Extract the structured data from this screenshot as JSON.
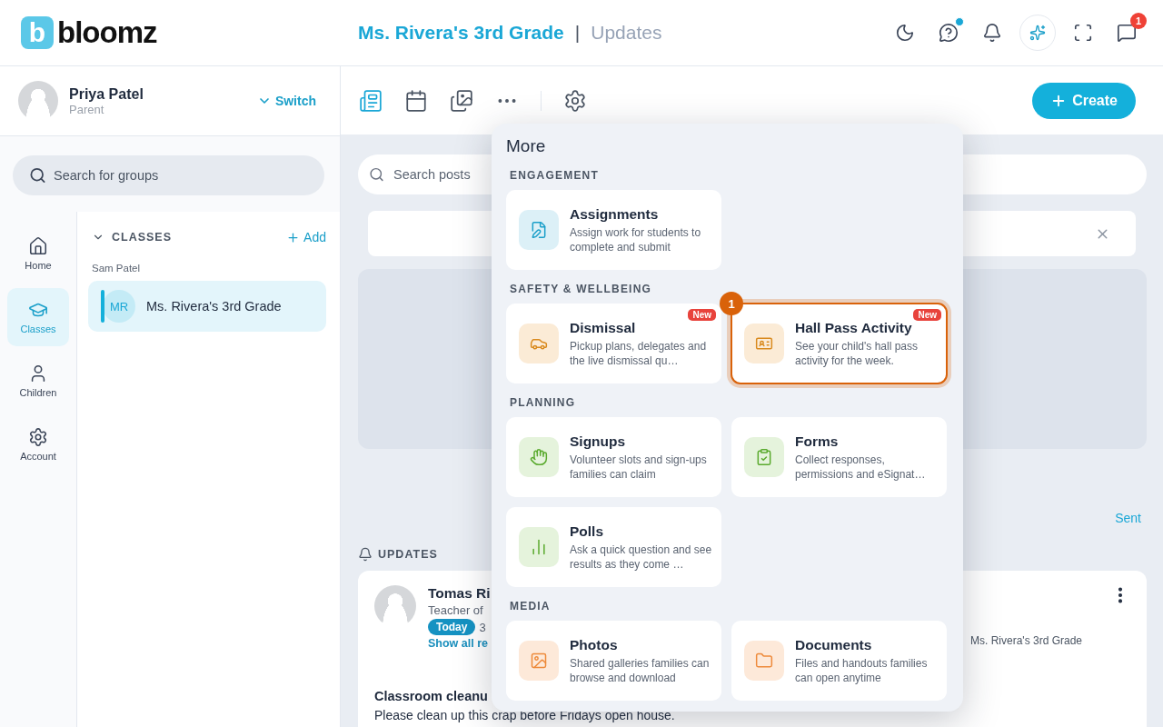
{
  "header": {
    "logo": "b",
    "brand": "bloomz",
    "title": "Ms. Rivera's 3rd Grade",
    "separator": "|",
    "section": "Updates",
    "actions": [
      {
        "kind": "theme"
      },
      {
        "kind": "help",
        "unread": true
      },
      {
        "kind": "notifications"
      },
      {
        "kind": "assistant"
      },
      {
        "kind": "fullscreen"
      },
      {
        "kind": "messages",
        "badge": "1"
      }
    ]
  },
  "profile": {
    "name": "Priya Patel",
    "role": "Parent",
    "switch_label": "Switch"
  },
  "group_search": {
    "placeholder": "Search for groups"
  },
  "nav": [
    {
      "kind": "home",
      "label": "Home",
      "selected": false
    },
    {
      "kind": "classes",
      "label": "Classes",
      "selected": true
    },
    {
      "kind": "children",
      "label": "Children",
      "selected": false
    },
    {
      "kind": "account",
      "label": "Account",
      "selected": false
    }
  ],
  "classes": {
    "heading": "CLASSES",
    "expanded": true,
    "add_label": "Add",
    "child": "Sam Patel",
    "items": [
      {
        "initials": "MR",
        "name": "Ms. Rivera's 3rd Grade",
        "selected": true
      }
    ]
  },
  "toolbar": {
    "tabs": [
      {
        "kind": "posts",
        "selected": true
      },
      {
        "kind": "calendar",
        "selected": false
      },
      {
        "kind": "photos",
        "selected": false
      },
      {
        "kind": "more",
        "selected": false
      },
      {
        "kind": "settings",
        "selected": false
      }
    ],
    "create_label": "Create"
  },
  "posts_search": {
    "placeholder": "Search posts"
  },
  "filter_label": "Sent",
  "updates_heading": "UPDATES",
  "post": {
    "author": "Tomas Ri",
    "role": "Teacher of",
    "tag": "Today",
    "time": "3",
    "link": "Show all re",
    "group": "Ms. Rivera's 3rd Grade",
    "title": "Classroom cleanu",
    "body": "Please clean up this crap before Fridays open house."
  },
  "more_menu": {
    "title": "More",
    "sections": [
      {
        "heading": "ENGAGEMENT",
        "items": [
          {
            "title": "Assignments",
            "description": "Assign work for students to complete and submit",
            "highlighted": false
          }
        ]
      },
      {
        "heading": "SAFETY & WELLBEING",
        "items": [
          {
            "title": "Dismissal",
            "description": "Pickup plans, delegates and the live dismissal qu…",
            "badge": "New",
            "highlighted": false
          },
          {
            "title": "Hall Pass Activity",
            "description": "See your child's hall pass activity for the week.",
            "badge": "New",
            "highlighted": true,
            "step": "1"
          }
        ]
      },
      {
        "heading": "PLANNING",
        "items": [
          {
            "title": "Signups",
            "description": "Volunteer slots and sign-ups families can claim",
            "highlighted": false
          },
          {
            "title": "Forms",
            "description": "Collect responses, permissions and eSignat…",
            "highlighted": false
          },
          {
            "title": "Polls",
            "description": "Ask a quick question and see results as they come …",
            "highlighted": false
          }
        ]
      },
      {
        "heading": "MEDIA",
        "items": [
          {
            "title": "Photos",
            "description": "Shared galleries families can browse and download",
            "highlighted": false
          },
          {
            "title": "Documents",
            "description": "Files and handouts families can open anytime",
            "highlighted": false
          }
        ]
      }
    ]
  }
}
